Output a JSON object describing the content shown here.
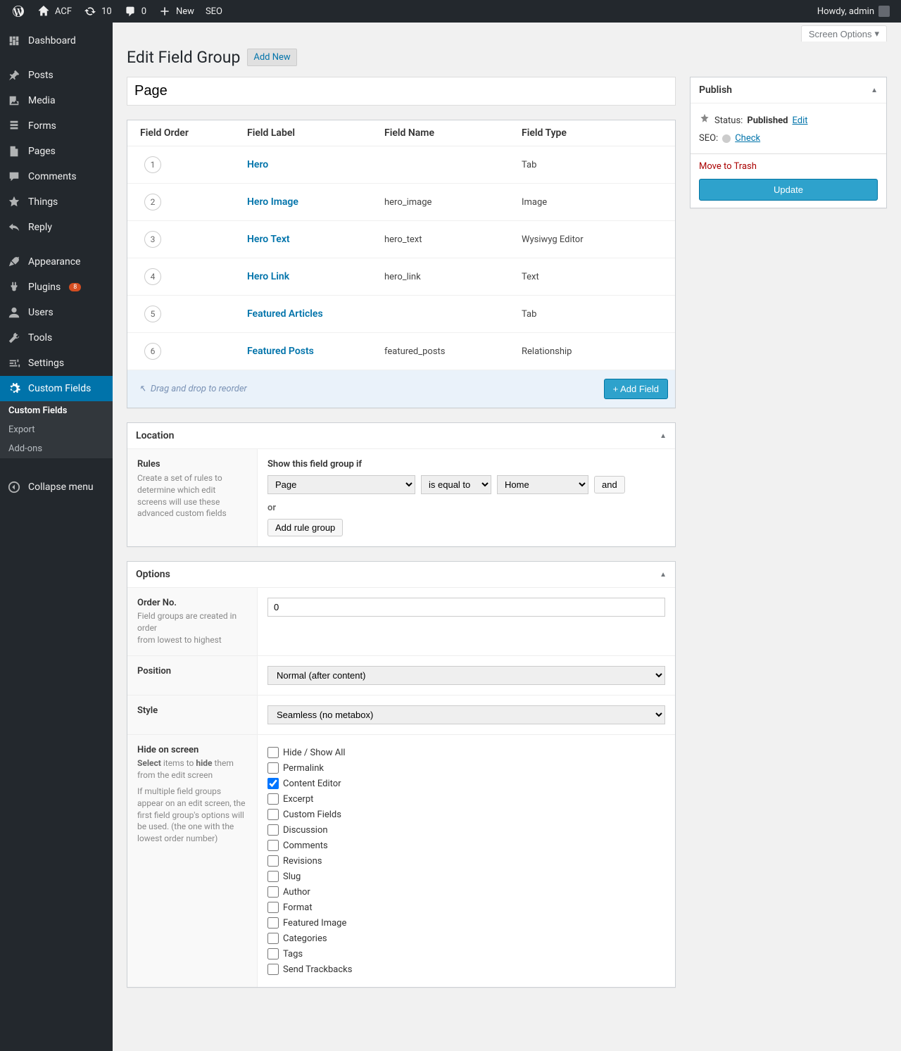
{
  "adminBar": {
    "site": "ACF",
    "updates": "10",
    "comments": "0",
    "newLabel": "New",
    "seoLabel": "SEO",
    "howdy": "Howdy, admin"
  },
  "sidebar": {
    "items": [
      {
        "icon": "dashboard",
        "label": "Dashboard"
      },
      {
        "icon": "pin",
        "label": "Posts"
      },
      {
        "icon": "media",
        "label": "Media"
      },
      {
        "icon": "forms",
        "label": "Forms"
      },
      {
        "icon": "page",
        "label": "Pages"
      },
      {
        "icon": "comment",
        "label": "Comments"
      },
      {
        "icon": "star",
        "label": "Things"
      },
      {
        "icon": "reply",
        "label": "Reply"
      },
      {
        "icon": "appearance",
        "label": "Appearance"
      },
      {
        "icon": "plugin",
        "label": "Plugins",
        "badge": "8"
      },
      {
        "icon": "users",
        "label": "Users"
      },
      {
        "icon": "tools",
        "label": "Tools"
      },
      {
        "icon": "settings",
        "label": "Settings"
      },
      {
        "icon": "gear",
        "label": "Custom Fields"
      }
    ],
    "sub": [
      {
        "label": "Custom Fields",
        "current": true
      },
      {
        "label": "Export"
      },
      {
        "label": "Add-ons"
      }
    ],
    "collapse": "Collapse menu"
  },
  "screenOptions": "Screen Options",
  "page": {
    "title": "Edit Field Group",
    "addNew": "Add New",
    "groupTitle": "Page"
  },
  "fieldsTable": {
    "headers": {
      "order": "Field Order",
      "label": "Field Label",
      "name": "Field Name",
      "type": "Field Type"
    },
    "rows": [
      {
        "order": "1",
        "label": "Hero",
        "name": "",
        "type": "Tab"
      },
      {
        "order": "2",
        "label": "Hero Image",
        "name": "hero_image",
        "type": "Image"
      },
      {
        "order": "3",
        "label": "Hero Text",
        "name": "hero_text",
        "type": "Wysiwyg Editor"
      },
      {
        "order": "4",
        "label": "Hero Link",
        "name": "hero_link",
        "type": "Text"
      },
      {
        "order": "5",
        "label": "Featured Articles",
        "name": "",
        "type": "Tab"
      },
      {
        "order": "6",
        "label": "Featured Posts",
        "name": "featured_posts",
        "type": "Relationship"
      }
    ],
    "dragHint": "Drag and drop to reorder",
    "addField": "+ Add Field"
  },
  "location": {
    "title": "Location",
    "rulesLabel": "Rules",
    "rulesDesc": "Create a set of rules to determine which edit screens will use these advanced custom fields",
    "lead": "Show this field group if",
    "param": "Page",
    "op": "is equal to",
    "value": "Home",
    "and": "and",
    "or": "or",
    "addRuleGroup": "Add rule group"
  },
  "options": {
    "title": "Options",
    "orderNo": {
      "label": "Order No.",
      "desc1": "Field groups are created in order",
      "desc2": "from lowest to highest",
      "value": "0"
    },
    "position": {
      "label": "Position",
      "value": "Normal (after content)"
    },
    "style": {
      "label": "Style",
      "value": "Seamless (no metabox)"
    },
    "hide": {
      "label": "Hide on screen",
      "desc1a": "Select",
      "desc1b": " items to ",
      "desc1c": "hide",
      "desc1d": " them from the edit screen",
      "desc2": "If multiple field groups appear on an edit screen, the first field group's options will be used. (the one with the lowest order number)",
      "items": [
        {
          "label": "Hide / Show All",
          "checked": false
        },
        {
          "label": "Permalink",
          "checked": false
        },
        {
          "label": "Content Editor",
          "checked": true
        },
        {
          "label": "Excerpt",
          "checked": false
        },
        {
          "label": "Custom Fields",
          "checked": false
        },
        {
          "label": "Discussion",
          "checked": false
        },
        {
          "label": "Comments",
          "checked": false
        },
        {
          "label": "Revisions",
          "checked": false
        },
        {
          "label": "Slug",
          "checked": false
        },
        {
          "label": "Author",
          "checked": false
        },
        {
          "label": "Format",
          "checked": false
        },
        {
          "label": "Featured Image",
          "checked": false
        },
        {
          "label": "Categories",
          "checked": false
        },
        {
          "label": "Tags",
          "checked": false
        },
        {
          "label": "Send Trackbacks",
          "checked": false
        }
      ]
    }
  },
  "publish": {
    "title": "Publish",
    "statusLabel": "Status:",
    "statusValue": "Published",
    "edit": "Edit",
    "seoLabel": "SEO:",
    "check": "Check",
    "trash": "Move to Trash",
    "update": "Update"
  }
}
